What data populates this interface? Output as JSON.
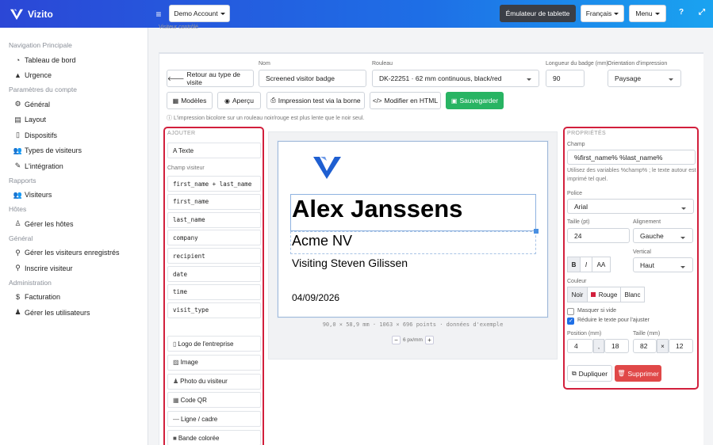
{
  "app": {
    "name": "Vizito"
  },
  "topbar": {
    "account": "Demo Account",
    "emulator": "Émulateur de tablette",
    "language": "Français",
    "menu": "Menu",
    "help_icon": "?",
    "expand_icon": "⤢"
  },
  "sidebar": {
    "sections": [
      {
        "title": "Navigation Principale",
        "items": [
          {
            "label": "Tableau de bord",
            "icon": "◔"
          },
          {
            "label": "Urgence",
            "icon": "▲"
          }
        ]
      },
      {
        "title": "Paramètres du compte",
        "items": [
          {
            "label": "Général",
            "icon": "⚙"
          },
          {
            "label": "Layout",
            "icon": "▤"
          },
          {
            "label": "Dispositifs",
            "icon": "▯"
          },
          {
            "label": "Types de visiteurs",
            "icon": "👥"
          },
          {
            "label": "L'intégration",
            "icon": "✎"
          }
        ]
      },
      {
        "title": "Rapports",
        "items": [
          {
            "label": "Visiteurs",
            "icon": "👥"
          }
        ]
      },
      {
        "title": "Hôtes",
        "items": [
          {
            "label": "Gérer les hôtes",
            "icon": "♙"
          }
        ]
      },
      {
        "title": "Général",
        "items": [
          {
            "label": "Gérer les visiteurs enregistrés",
            "icon": "⚲"
          },
          {
            "label": "Inscrire visiteur",
            "icon": "⚲"
          }
        ]
      },
      {
        "title": "Administration",
        "items": [
          {
            "label": "Facturation",
            "icon": "$"
          },
          {
            "label": "Gérer les utilisateurs",
            "icon": "♟"
          }
        ]
      }
    ]
  },
  "breadcrumb": "Visiteur contrôlé",
  "form": {
    "back_button": "Retour au type de visite",
    "name_label": "Nom",
    "name_value": "Screened visitor badge",
    "roll_label": "Rouleau",
    "roll_value": "DK-22251 · 62 mm continuous, black/red",
    "length_label": "Longueur du badge (mm)",
    "length_value": "90",
    "orientation_label": "Orientation d'impression",
    "orientation_value": "Paysage"
  },
  "toolbar": {
    "models": "Modèles",
    "preview": "Aperçu",
    "test_print": "Impression test via la borne",
    "edit_html": "Modifier en HTML",
    "save": "Sauvegarder"
  },
  "note": "L'impression bicolore sur un rouleau noir/rouge est plus lente que le noir seul.",
  "add_panel": {
    "title": "AJOUTER",
    "text_item": "A  Texte",
    "fields_label": "Champ visiteur",
    "fields": [
      "first_name + last_name",
      "first_name",
      "last_name",
      "company",
      "recipient",
      "date",
      "time",
      "visit_type"
    ],
    "elements": [
      {
        "icon": "▯",
        "label": "Logo de l'entreprise"
      },
      {
        "icon": "▨",
        "label": "Image"
      },
      {
        "icon": "♟",
        "label": "Photo du visiteur"
      },
      {
        "icon": "▦",
        "label": "Code QR"
      },
      {
        "icon": "—",
        "label": "Ligne / cadre"
      },
      {
        "icon": "■",
        "label": "Bande colorée"
      }
    ]
  },
  "badge": {
    "name": "Alex Janssens",
    "company": "Acme NV",
    "visiting": "Visiting Steven Gilissen",
    "date": "04/09/2026",
    "meta": "90,0 × 58,9 mm · 1063 × 696 points · données d'exemple",
    "zoom": "6 px/mm",
    "logo_color": "#1f5fd1"
  },
  "props": {
    "title": "PROPRIÉTÉS",
    "field_label": "Champ",
    "field_value": "%first_name% %last_name%",
    "hint": "Utilisez des variables %champ% ; le texte autour est imprimé tel quel.",
    "font_label": "Police",
    "font_value": "Arial",
    "size_label": "Taille (pt)",
    "size_value": "24",
    "align_label": "Alignement",
    "align_value": "Gauche",
    "bold": "B",
    "italic": "I",
    "caps": "AA",
    "vertical_label": "Vertical",
    "vertical_value": "Haut",
    "color_label": "Couleur",
    "colors": [
      "Noir",
      "Rouge",
      "Blanc"
    ],
    "red_swatch": "#d21f3c",
    "mask_label": "Masquer si vide",
    "mask_checked": false,
    "shrink_label": "Réduire le texte pour l'ajuster",
    "shrink_checked": true,
    "pos_label": "Position (mm)",
    "pos_x": "4",
    "pos_sep": ",",
    "pos_y": "18",
    "dim_label": "Taille (mm)",
    "dim_w": "82",
    "dim_sep": "×",
    "dim_h": "12",
    "duplicate": "Dupliquer",
    "delete": "Supprimer"
  }
}
